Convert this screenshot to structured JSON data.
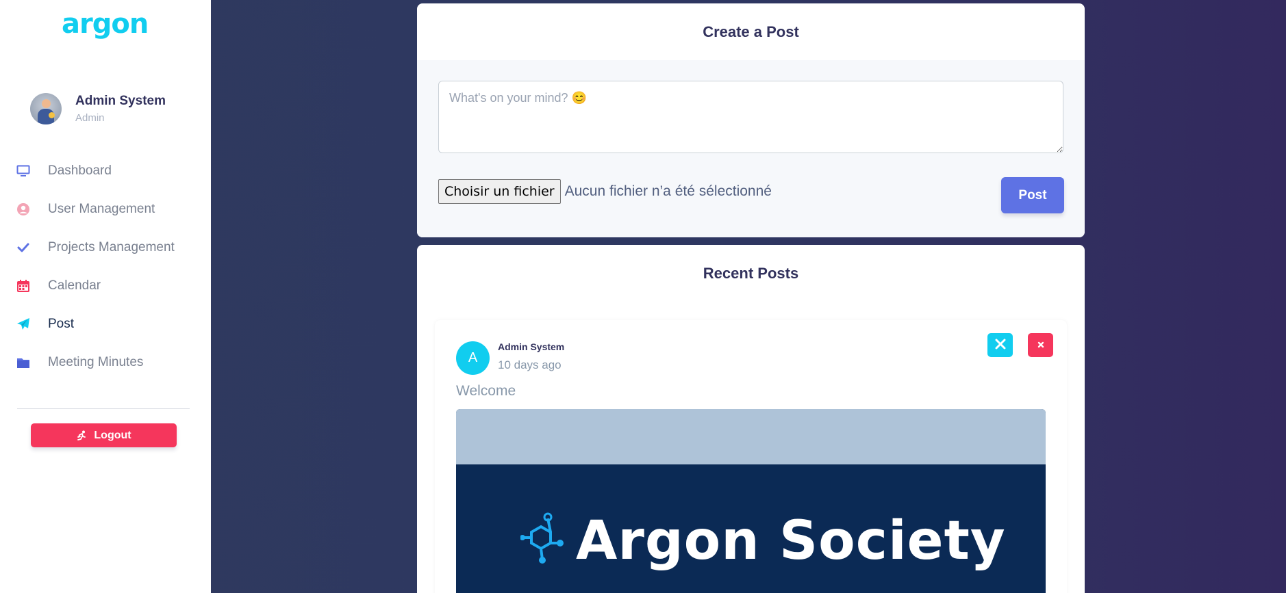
{
  "brand": {
    "name": "argon",
    "color": "#11cdef"
  },
  "user": {
    "name": "Admin System",
    "role": "Admin"
  },
  "nav": {
    "items": [
      {
        "label": "Dashboard",
        "icon": "monitor-icon",
        "color": "#5e72e4"
      },
      {
        "label": "User Management",
        "icon": "user-circle-icon",
        "color": "#f3a4b5"
      },
      {
        "label": "Projects Management",
        "icon": "check-icon",
        "color": "#5e72e4"
      },
      {
        "label": "Calendar",
        "icon": "calendar-icon",
        "color": "#f5365c"
      },
      {
        "label": "Post",
        "icon": "paper-plane-icon",
        "color": "#11cdef",
        "active": true
      },
      {
        "label": "Meeting Minutes",
        "icon": "folder-icon",
        "color": "#5e72e4"
      }
    ]
  },
  "logout": {
    "label": "Logout",
    "icon": "running-icon"
  },
  "create_post": {
    "title": "Create a Post",
    "placeholder": "What's on your mind? 😊",
    "file_button": "Choisir un fichier",
    "file_status": "Aucun fichier n’a été sélectionné",
    "submit_label": "Post"
  },
  "recent_posts": {
    "title": "Recent Posts",
    "posts": [
      {
        "avatar_initial": "A",
        "author": "Admin System",
        "time": "10 days ago",
        "text": "Welcome",
        "image_text": "Argon Society",
        "actions": [
          {
            "icon": "tools-icon",
            "color": "#11cdef"
          },
          {
            "icon": "close-icon",
            "color": "#f5365c"
          }
        ]
      }
    ]
  },
  "colors": {
    "primary": "#5e72e4",
    "info": "#11cdef",
    "danger": "#f5365c",
    "heading": "#32325d"
  }
}
